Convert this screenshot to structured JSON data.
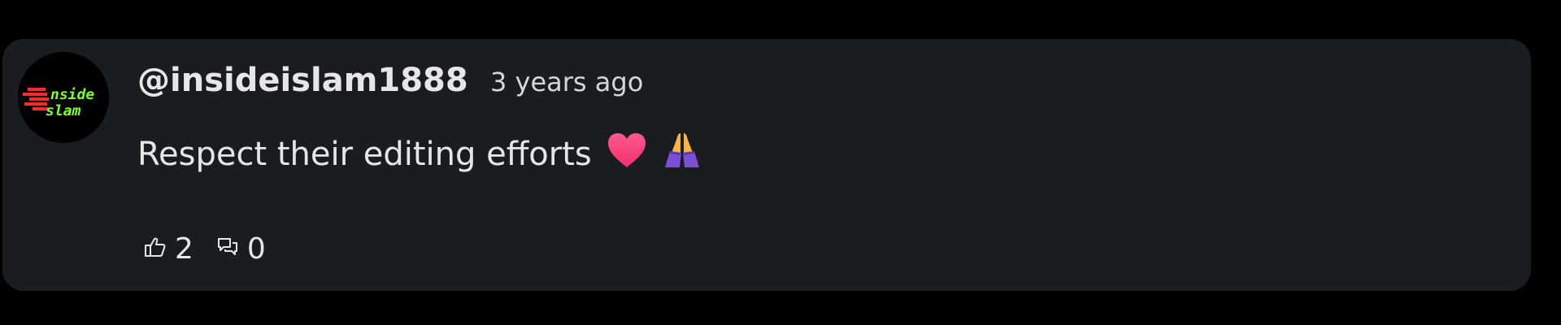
{
  "comment": {
    "author": "@insideislam1888",
    "timestamp": "3 years ago",
    "text": "Respect their editing efforts",
    "emojis": [
      "heart-emoji",
      "folded-hands-emoji"
    ],
    "avatar": {
      "line1": "nside",
      "line2": "slam",
      "colors": {
        "background": "#000000",
        "text": "#7cff2a",
        "flame": "#ff2b2b"
      }
    },
    "likes": "2",
    "replies": "0"
  },
  "colors": {
    "page_background": "#000000",
    "card_background": "#1b1c1f",
    "text": "#e6e6e6",
    "heart": "#ff3d7f",
    "hands": "#f6b73c",
    "sleeve": "#7a4fd6"
  }
}
